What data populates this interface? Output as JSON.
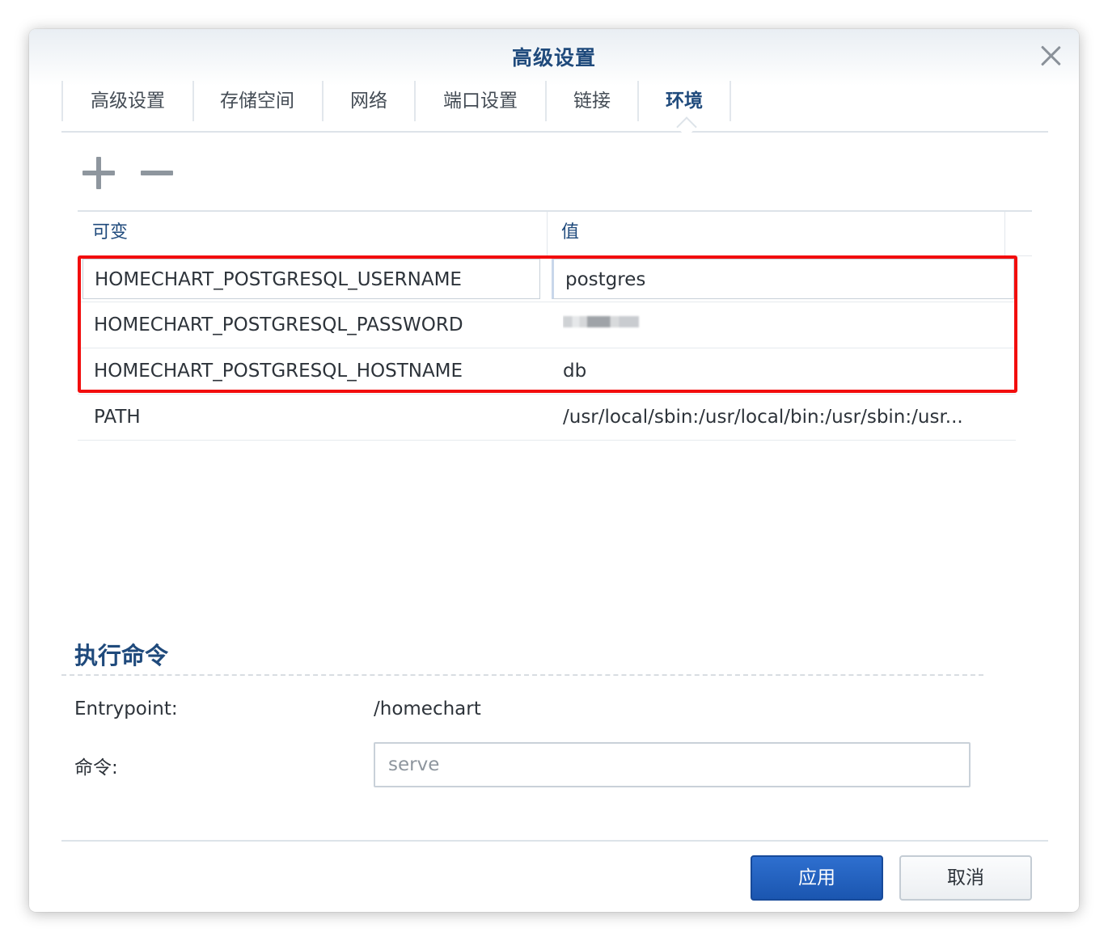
{
  "dialog": {
    "title": "高级设置"
  },
  "tabs": [
    {
      "label": "高级设置"
    },
    {
      "label": "存储空间"
    },
    {
      "label": "网络"
    },
    {
      "label": "端口设置"
    },
    {
      "label": "链接"
    },
    {
      "label": "环境"
    }
  ],
  "toolbar": {
    "add_icon": "plus-icon",
    "remove_icon": "minus-icon"
  },
  "env_table": {
    "headers": {
      "variable": "可变",
      "value": "值"
    },
    "rows": [
      {
        "name": "HOMECHART_POSTGRESQL_USERNAME",
        "value": "postgres"
      },
      {
        "name": "HOMECHART_POSTGRESQL_PASSWORD",
        "value": ""
      },
      {
        "name": "HOMECHART_POSTGRESQL_HOSTNAME",
        "value": "db"
      },
      {
        "name": "PATH",
        "value": "/usr/local/sbin:/usr/local/bin:/usr/sbin:/usr..."
      }
    ]
  },
  "exec": {
    "section_title": "执行命令",
    "entrypoint_label": "Entrypoint:",
    "entrypoint_value": "/homechart",
    "command_label": "命令:",
    "command_placeholder": "serve"
  },
  "footer": {
    "apply_label": "应用",
    "cancel_label": "取消"
  },
  "colors": {
    "accent": "#1f4a7c",
    "primary_button": "#1b56b0",
    "highlight_box": "#f20d0d"
  }
}
